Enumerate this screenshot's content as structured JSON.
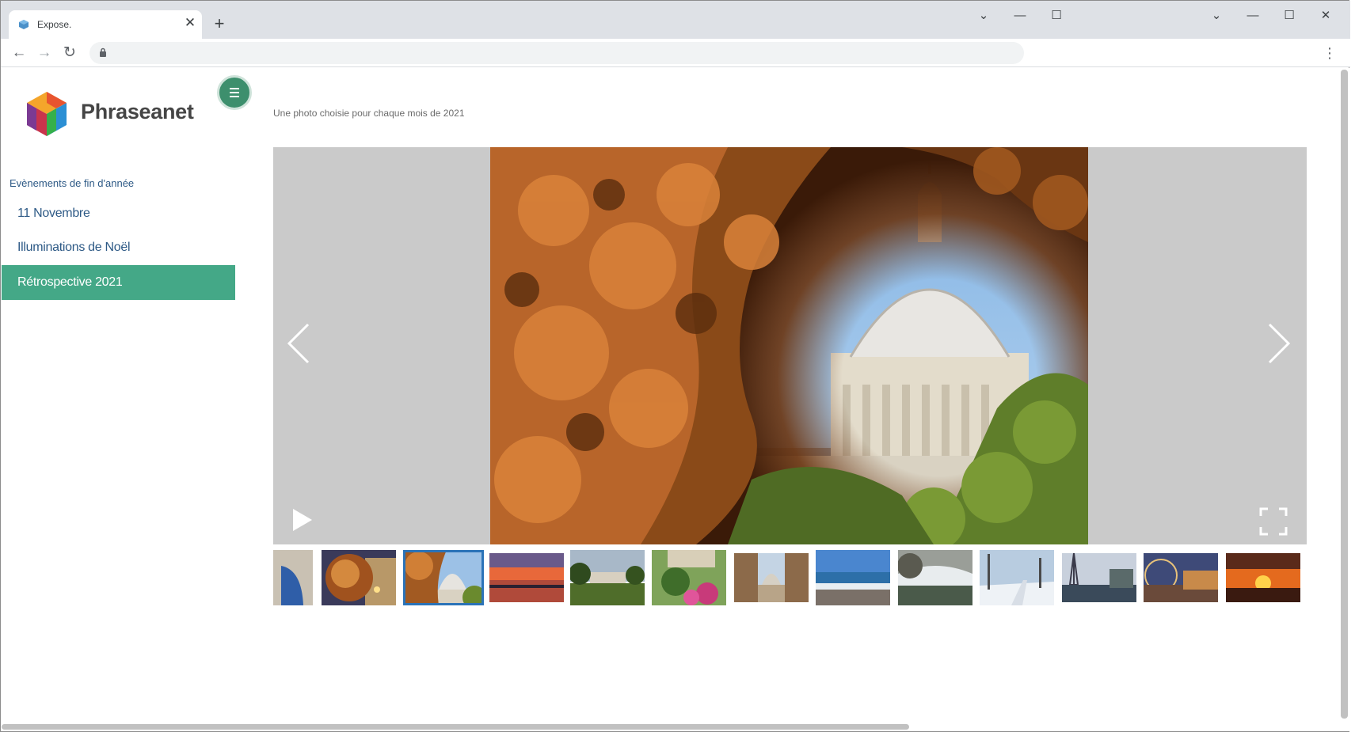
{
  "browser": {
    "tab_title": "Expose.",
    "tab_close": "✕",
    "new_tab": "+",
    "nav": {
      "back": "←",
      "forward": "→",
      "reload": "↻"
    },
    "menu": "⋮",
    "window_controls": {
      "tab_search": "⌄",
      "minimize": "—",
      "maximize": "☐",
      "close": "✕"
    }
  },
  "sidebar": {
    "brand": "Phraseanet",
    "section_title": "Evènements de fin d'année",
    "items": [
      {
        "label": "11 Novembre",
        "active": false
      },
      {
        "label": "Illuminations de Noël",
        "active": false
      },
      {
        "label": "Rétrospective 2021",
        "active": true
      }
    ]
  },
  "gallery": {
    "description": "Une photo choisie pour chaque mois de 2021",
    "selected_index": 2,
    "thumbnail_subjects": [
      "stone archway with blue sky",
      "autumn tree lit by street lamps",
      "autumn leaves framing a dome",
      "sunset over a river",
      "park lawn with palace",
      "flowering garden",
      "street leading to a dome",
      "beach with waves",
      "snowy bridge in a park",
      "snowy tree-lined path",
      "Eiffel Tower over rooftops",
      "ferris wheel and palace",
      "orange sunset over a bridge"
    ]
  },
  "colors": {
    "accent_green": "#44a887",
    "menu_button": "#3d8f6d",
    "link_blue": "#2e5a86",
    "stage_gray": "#cacaca",
    "selected_thumb": "#2b73b8"
  },
  "icons": [
    "back-arrow-icon",
    "forward-arrow-icon",
    "reload-icon",
    "lock-icon",
    "hamburger-icon",
    "chevron-left-icon",
    "chevron-right-icon",
    "play-icon",
    "fullscreen-icon"
  ]
}
